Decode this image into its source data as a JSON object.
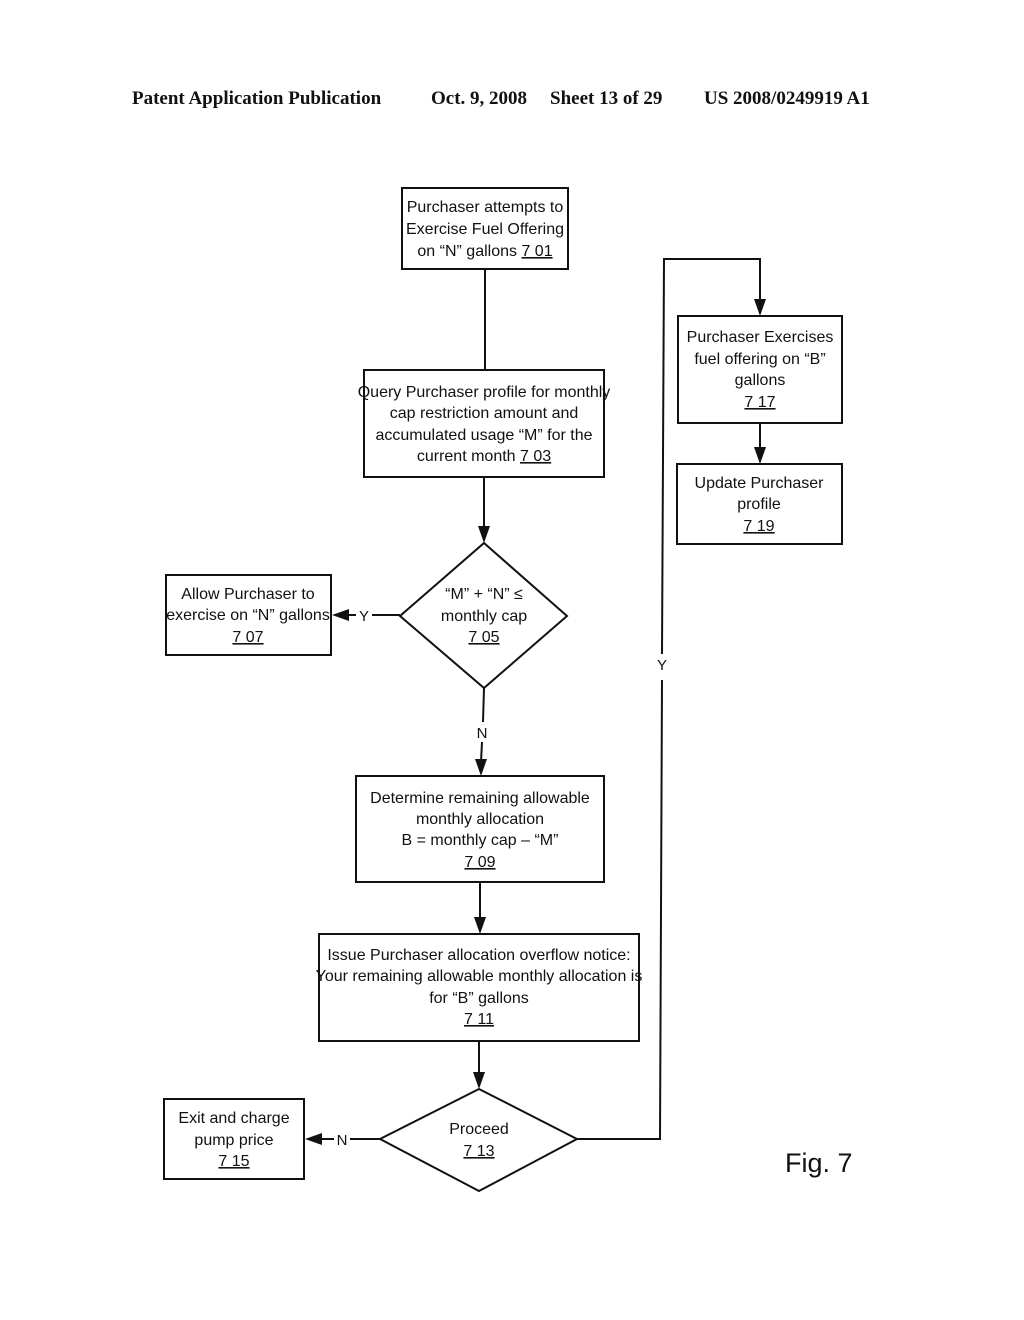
{
  "header": {
    "title": "Patent Application Publication",
    "date": "Oct. 9, 2008",
    "sheet": "Sheet 13 of 29",
    "publication_number": "US 2008/0249919 A1"
  },
  "figure_label": "Fig. 7",
  "nodes": {
    "n701": {
      "type": "process",
      "lines": [
        "Purchaser attempts to",
        "Exercise Fuel Offering",
        "on “N” gallons"
      ],
      "ref": "7 01"
    },
    "n703": {
      "type": "process",
      "lines": [
        "Query Purchaser profile for monthly",
        "cap restriction amount and",
        "accumulated  usage “M” for the",
        "current month"
      ],
      "ref": "7 03"
    },
    "n705": {
      "type": "decision",
      "lines": [
        "“M” + “N” ≤",
        "monthly cap"
      ],
      "ref": "7 05"
    },
    "n707": {
      "type": "process",
      "lines": [
        "Allow Purchaser to",
        "exercise on “N” gallons"
      ],
      "ref": "7 07"
    },
    "n709": {
      "type": "process",
      "lines": [
        "Determine remaining allowable",
        "monthly allocation",
        "B = monthly cap – “M”"
      ],
      "ref": "7 09"
    },
    "n711": {
      "type": "process",
      "lines": [
        "Issue Purchaser allocation overflow notice:",
        "Your remaining allowable monthly allocation is",
        "for “B” gallons"
      ],
      "ref": "7 11"
    },
    "n713": {
      "type": "decision",
      "lines": [
        "Proceed"
      ],
      "ref": "7 13"
    },
    "n715": {
      "type": "process",
      "lines": [
        "Exit and charge",
        "pump price"
      ],
      "ref": "7 15"
    },
    "n717": {
      "type": "process",
      "lines": [
        "Purchaser Exercises",
        "fuel offering  on “B”",
        "gallons"
      ],
      "ref": "7 17"
    },
    "n719": {
      "type": "process",
      "lines": [
        "Update Purchaser",
        "profile"
      ],
      "ref": "7 19"
    }
  },
  "edges": [
    {
      "from": "n701",
      "to": "n703",
      "label": ""
    },
    {
      "from": "n703",
      "to": "n705",
      "label": ""
    },
    {
      "from": "n705",
      "to": "n707",
      "label": "Y"
    },
    {
      "from": "n705",
      "to": "n709",
      "label": "N"
    },
    {
      "from": "n709",
      "to": "n711",
      "label": ""
    },
    {
      "from": "n711",
      "to": "n713",
      "label": ""
    },
    {
      "from": "n713",
      "to": "n715",
      "label": "N"
    },
    {
      "from": "n713",
      "to": "n717",
      "label": "Y"
    },
    {
      "from": "n717",
      "to": "n719",
      "label": ""
    }
  ]
}
